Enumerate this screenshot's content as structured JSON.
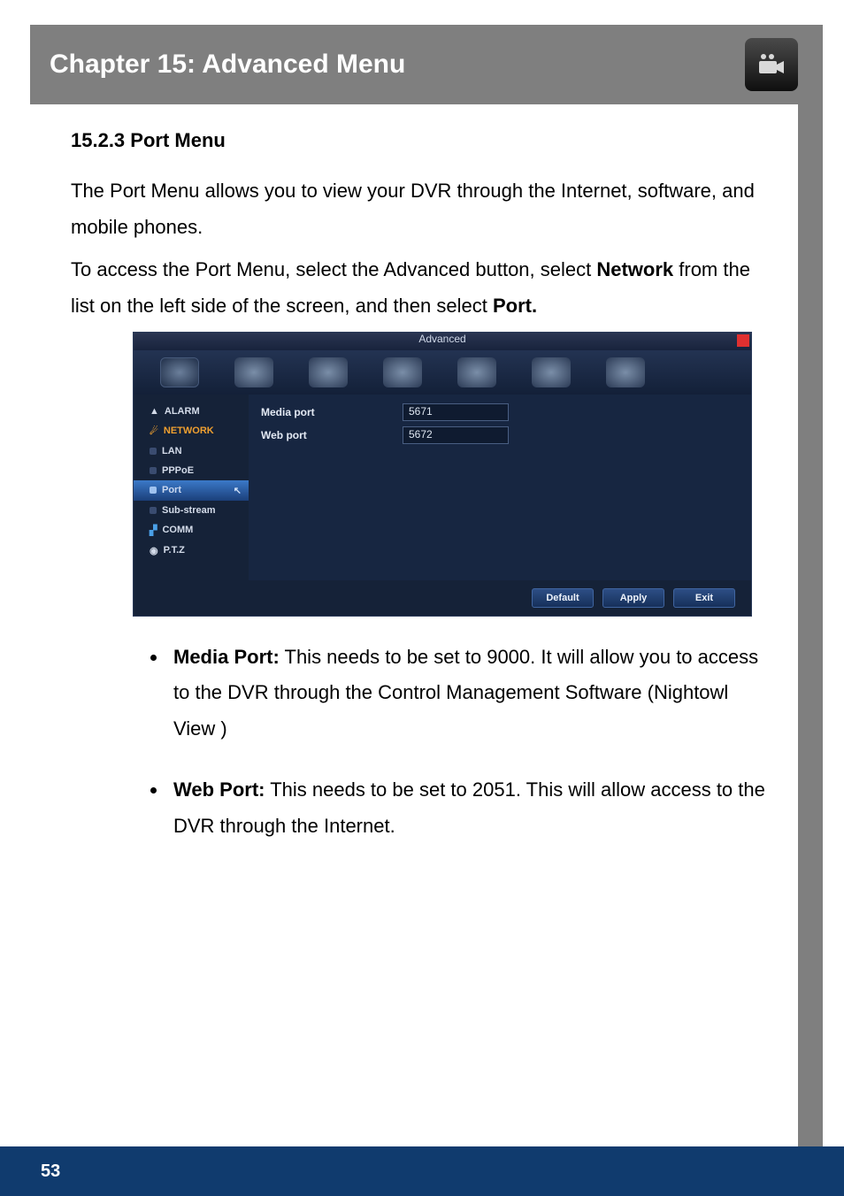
{
  "chapter": {
    "title": "Chapter 15: Advanced Menu"
  },
  "section": {
    "heading": "15.2.3 Port Menu",
    "para1": "The Port Menu allows you to view your DVR through the Internet, software, and mobile phones.",
    "para2_a": "To access the Port Menu, select the Advanced button, select ",
    "para2_b": "Network",
    "para2_c": " from the list on the left side of the screen, and then select ",
    "para2_d": "Port."
  },
  "screenshot": {
    "title": "Advanced",
    "side_items": {
      "alarm": "ALARM",
      "network": "NETWORK",
      "lan": "LAN",
      "pppoe": "PPPoE",
      "port": "Port",
      "substream": "Sub-stream",
      "comm": "COMM",
      "ptz": "P.T.Z"
    },
    "fields": {
      "media_label": "Media port",
      "media_value": "5671",
      "web_label": "Web port",
      "web_value": "5672"
    },
    "buttons": {
      "default": "Default",
      "apply": "Apply",
      "exit": "Exit"
    }
  },
  "bullets": {
    "b1_strong": "Media Port:",
    "b1_rest": " This needs to be set to 9000. It will allow you to access to the DVR through the Control Management Software (Nightowl View )",
    "b2_strong": "Web Port:",
    "b2_rest": " This needs to be set to 2051. This will allow access to the DVR through the Internet."
  },
  "page_number": "53"
}
